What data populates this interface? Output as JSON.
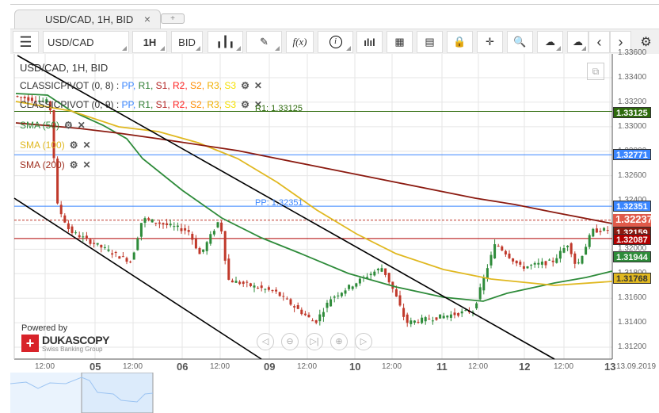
{
  "tab": {
    "title": "USD/CAD, 1H, BID",
    "close": "×",
    "add": "+"
  },
  "toolbar": {
    "instrument": "USD/CAD",
    "period": "1H",
    "side": "BID",
    "fx": "f(x)",
    "info": "i"
  },
  "legend": {
    "title": "USD/CAD, 1H, BID",
    "pivot1": "CLASSICPIVOT (0, 8)",
    "pivot2": "CLASSICPIVOT (0, 9)",
    "pivot_sep": " : ",
    "pivot_items": [
      {
        "t": "PP",
        "c": "#3a86ff"
      },
      {
        "t": "R1",
        "c": "#2e7d32"
      },
      {
        "t": "S1",
        "c": "#b22222"
      },
      {
        "t": "R2",
        "c": "#ff2020"
      },
      {
        "t": "S2",
        "c": "#ff8c00"
      },
      {
        "t": "R3",
        "c": "#f0b000"
      },
      {
        "t": "S3",
        "c": "#f5e000"
      }
    ],
    "sma50": "SMA (50)",
    "sma100": "SMA (100)",
    "sma200": "SMA (200)"
  },
  "line_labels": {
    "r1": "R1: 1.33125",
    "pp": "PP: 1.32351"
  },
  "price_axis": [
    "1.33600",
    "1.33400",
    "1.33200",
    "1.33000",
    "1.32800",
    "1.32600",
    "1.32400",
    "1.32200",
    "1.32000",
    "1.31800",
    "1.31600",
    "1.31400",
    "1.31200"
  ],
  "price_boxes": [
    {
      "v": "1.33125",
      "bg": "#2e6b0c",
      "c": "#fff"
    },
    {
      "v": "1.32771",
      "bg": "#3a86ff",
      "c": "#fff"
    },
    {
      "v": "1.32351",
      "bg": "#3a86ff",
      "c": "#fff"
    },
    {
      "v": "1.32237",
      "bg": "#e05a4a",
      "c": "#fff"
    },
    {
      "v": "1.32159",
      "bg": "#8b1a10",
      "c": "#fff"
    },
    {
      "v": "1.32087",
      "bg": "#b00000",
      "c": "#fff"
    },
    {
      "v": "1.31944",
      "bg": "#2e8b3a",
      "c": "#fff"
    },
    {
      "v": "1.31768",
      "bg": "#e0b820",
      "c": "#333"
    }
  ],
  "time_axis": [
    {
      "t": "12:00"
    },
    {
      "t": "05",
      "d": 1
    },
    {
      "t": "12:00"
    },
    {
      "t": "06",
      "d": 1
    },
    {
      "t": "12:00"
    },
    {
      "t": "09",
      "d": 1
    },
    {
      "t": "12:00"
    },
    {
      "t": "10",
      "d": 1
    },
    {
      "t": "12:00"
    },
    {
      "t": "11",
      "d": 1
    },
    {
      "t": "12:00"
    },
    {
      "t": "12",
      "d": 1
    },
    {
      "t": "12:00"
    },
    {
      "t": "13",
      "d": 1
    }
  ],
  "current_date": "13.09.2019",
  "branding": {
    "powered": "Powered by",
    "name": "DUKASCOPY",
    "sub": "Swiss Banking Group"
  },
  "colors": {
    "sma50": "#2e8b3a",
    "sma100": "#e0b820",
    "sma200": "#8b1a10",
    "up": "#2e8b3a",
    "down": "#c0392b"
  }
}
